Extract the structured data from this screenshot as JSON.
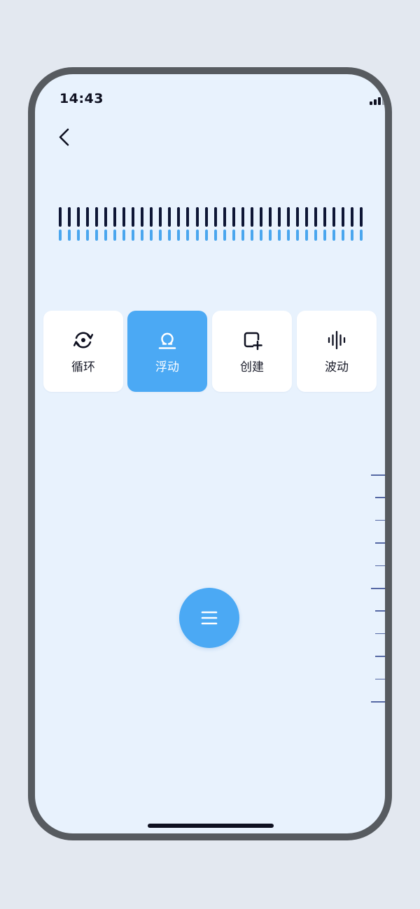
{
  "status": {
    "time": "14:43",
    "icons": [
      "signal-icon",
      "wifi-icon",
      "battery-charging-icon"
    ],
    "battery_color": "#3ac25a"
  },
  "nav": {
    "back_icon": "chevron-left-icon"
  },
  "visualizer": {
    "dark_tick_color": "#0e1635",
    "blue_tick_color": "#4aa6ee"
  },
  "modes": [
    {
      "label": "循环",
      "icon": "cycle-icon",
      "active": false
    },
    {
      "label": "浮动",
      "icon": "float-icon",
      "active": true
    },
    {
      "label": "创建",
      "icon": "create-icon",
      "active": false
    },
    {
      "label": "波动",
      "icon": "wave-icon",
      "active": false
    }
  ],
  "fab": {
    "icon": "menu-icon"
  },
  "colors": {
    "accent": "#4ba9f4",
    "background": "#e8f2fd",
    "frame": "#575b60"
  }
}
